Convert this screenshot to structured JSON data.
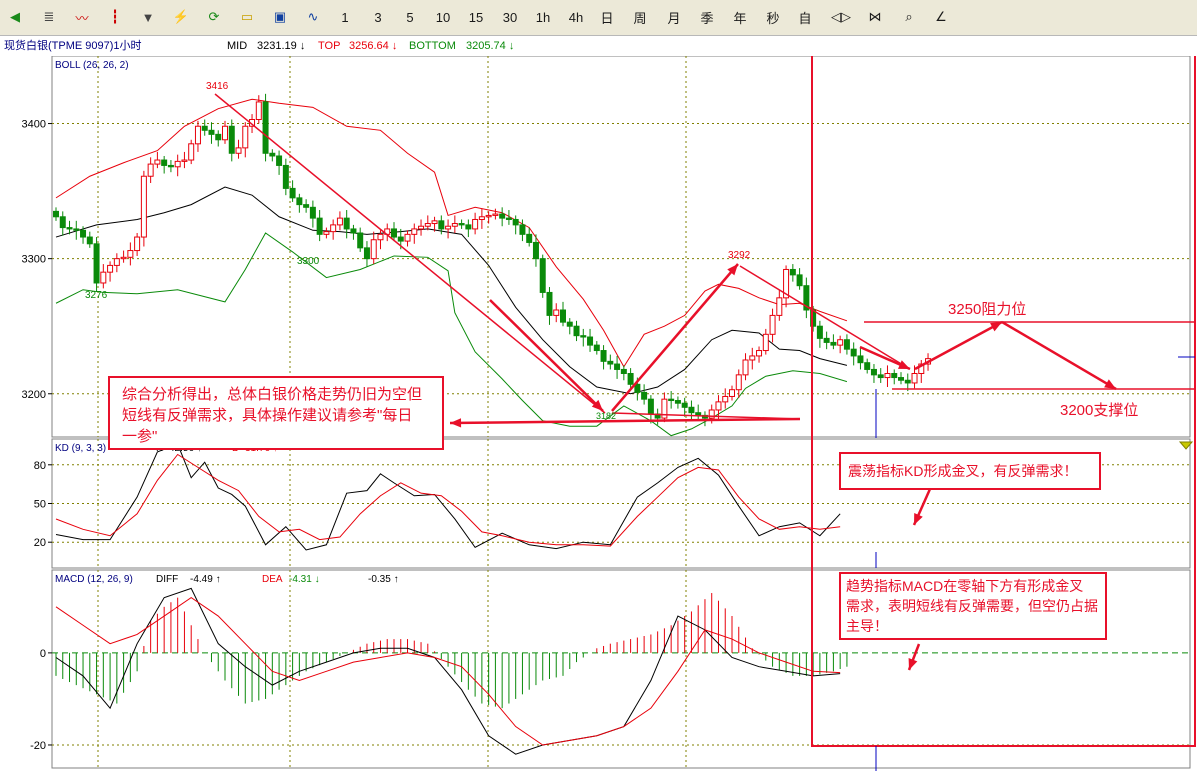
{
  "toolbar": {
    "icons": [
      {
        "name": "back-icon",
        "glyph": "◀"
      },
      {
        "name": "list-view-icon",
        "glyph": "≣"
      },
      {
        "name": "line-chart-icon",
        "glyph": "〰"
      },
      {
        "name": "candlestick-icon",
        "glyph": "┇"
      },
      {
        "name": "dropdown-icon",
        "glyph": "▼"
      },
      {
        "name": "lightning-icon",
        "glyph": "⚡"
      },
      {
        "name": "refresh-icon",
        "glyph": "⟳"
      },
      {
        "name": "open-folder-icon",
        "glyph": "▭"
      },
      {
        "name": "save-icon",
        "glyph": "▣"
      },
      {
        "name": "indicator-icon",
        "glyph": "∿"
      }
    ],
    "periods": [
      "1",
      "3",
      "5",
      "10",
      "15",
      "30",
      "1h",
      "4h",
      "日",
      "周",
      "月",
      "季",
      "年",
      "秒",
      "自"
    ],
    "tools": [
      {
        "name": "zoom-horizontal-icon",
        "glyph": "◁▷"
      },
      {
        "name": "zoom-fit-icon",
        "glyph": "⋈"
      },
      {
        "name": "search-icon",
        "glyph": "⌕"
      },
      {
        "name": "draw-icon",
        "glyph": "∠"
      }
    ]
  },
  "infobar": {
    "title": "现货白银(TPME 9097)1小时",
    "mid_label": "MID",
    "mid_value": "3231.19 ↓",
    "top_label": "TOP",
    "top_value": "3256.64 ↓",
    "bottom_label": "BOTTOM",
    "bottom_value": "3205.74 ↓"
  },
  "colors": {
    "up": "#e8000b",
    "down": "#0a8a0a",
    "mid": "#000000",
    "annotation": "#e8102a",
    "grid": "#808000"
  },
  "chart_data": [
    {
      "type": "candlestick",
      "title": "BOLL (26, 26, 2)",
      "yticks": [
        3400,
        3300,
        3200
      ],
      "ylim": [
        3168,
        3450
      ],
      "series": [
        {
          "name": "MID",
          "type": "line",
          "color": "#000000",
          "x": [
            0,
            6,
            12,
            16,
            20,
            25,
            29,
            33,
            38,
            42,
            46,
            51,
            55,
            60,
            64,
            68,
            72,
            76,
            80,
            85,
            89,
            93,
            97,
            100,
            104,
            107,
            110,
            113,
            117
          ],
          "y": [
            3316,
            3325,
            3329,
            3334,
            3340,
            3353,
            3347,
            3331,
            3321,
            3320,
            3318,
            3320,
            3322,
            3318,
            3295,
            3264,
            3240,
            3220,
            3205,
            3200,
            3205,
            3218,
            3240,
            3247,
            3245,
            3233,
            3232,
            3226,
            3221
          ]
        },
        {
          "name": "TOP",
          "type": "line",
          "color": "#e8000b",
          "x": [
            0,
            5,
            10,
            15,
            19,
            24,
            29,
            33,
            38,
            43,
            48,
            52,
            56,
            58,
            62,
            66,
            70,
            74,
            78,
            81,
            84,
            87,
            90,
            93,
            96,
            98,
            101,
            104,
            107,
            110,
            113,
            117
          ],
          "y": [
            3345,
            3361,
            3371,
            3380,
            3398,
            3411,
            3418,
            3415,
            3412,
            3398,
            3395,
            3378,
            3364,
            3332,
            3338,
            3334,
            3323,
            3294,
            3270,
            3247,
            3220,
            3244,
            3250,
            3258,
            3276,
            3281,
            3278,
            3271,
            3266,
            3267,
            3261,
            3254
          ]
        },
        {
          "name": "BOTTOM",
          "type": "line",
          "color": "#0a8a0a",
          "x": [
            0,
            4,
            7,
            12,
            18,
            25,
            28,
            31,
            35,
            40,
            45,
            50,
            55,
            58,
            59,
            62,
            66,
            69,
            72,
            76,
            80,
            84,
            88,
            91,
            94,
            97,
            100,
            102,
            105,
            109,
            113,
            117
          ],
          "y": [
            3267,
            3277,
            3275,
            3274,
            3277,
            3268,
            3292,
            3319,
            3305,
            3286,
            3292,
            3302,
            3301,
            3291,
            3260,
            3231,
            3211,
            3195,
            3180,
            3176,
            3176,
            3191,
            3180,
            3169,
            3174,
            3182,
            3191,
            3204,
            3213,
            3217,
            3215,
            3209
          ]
        },
        {
          "name": "Close",
          "type": "candles",
          "up_color": "#e8000b",
          "down_color": "#0a8a0a",
          "close": [
            3331,
            3323,
            3322,
            3321,
            3316,
            3311,
            3282,
            3290,
            3295,
            3300,
            3301,
            3306,
            3316,
            3361,
            3370,
            3373,
            3369,
            3368,
            3372,
            3373,
            3385,
            3398,
            3395,
            3392,
            3388,
            3398,
            3378,
            3382,
            3398,
            3403,
            3416,
            3378,
            3376,
            3369,
            3352,
            3345,
            3340,
            3338,
            3330,
            3318,
            3320,
            3325,
            3330,
            3322,
            3319,
            3308,
            3300,
            3314,
            3318,
            3322,
            3316,
            3313,
            3318,
            3322,
            3324,
            3326,
            3328,
            3322,
            3324,
            3326,
            3325,
            3322,
            3329,
            3331,
            3332,
            3333,
            3330,
            3329,
            3325,
            3318,
            3312,
            3300,
            3275,
            3258,
            3262,
            3253,
            3250,
            3243,
            3242,
            3236,
            3232,
            3224,
            3222,
            3218,
            3215,
            3207,
            3201,
            3196,
            3185,
            3182,
            3196,
            3195,
            3193,
            3190,
            3186,
            3184,
            3182,
            3188,
            3194,
            3198,
            3203,
            3214,
            3225,
            3228,
            3232,
            3244,
            3258,
            3271,
            3292,
            3288,
            3280,
            3262,
            3250,
            3241,
            3238,
            3236,
            3240,
            3233,
            3228,
            3223,
            3218,
            3214,
            3212,
            3215,
            3212,
            3210,
            3208,
            3215,
            3222,
            3226
          ]
        }
      ],
      "annotations": [
        {
          "text": "3416",
          "color": "#e8000b"
        },
        {
          "text": "3300",
          "color": "#0a8a0a"
        },
        {
          "text": "3276",
          "color": "#0a8a0a"
        },
        {
          "text": "3292",
          "color": "#e8000b"
        },
        {
          "text": "3182",
          "color": "#0a8a0a"
        },
        {
          "text": "3250阻力位",
          "color": "#e8102a"
        },
        {
          "text": "3200支撑位",
          "color": "#e8102a"
        },
        {
          "text": "综合分析得出，总体白银价格走势仍旧为空但短线有反弹需求，具体操作建议请参考\"每日一参\"",
          "color": "#e8102a"
        }
      ],
      "xlabel": "",
      "ylabel": ""
    },
    {
      "type": "line",
      "title": "KD (9, 3, 3)",
      "header": [
        {
          "label": "K",
          "value": "42.56 ↑"
        },
        {
          "label": "D",
          "value": "31.76 ↑"
        }
      ],
      "yticks": [
        80,
        50,
        20
      ],
      "ylim": [
        0,
        100
      ],
      "series": [
        {
          "name": "K",
          "color": "#000000",
          "x": [
            0,
            4,
            8,
            12,
            15,
            18,
            20,
            22,
            24,
            26,
            28,
            31,
            34,
            37,
            40,
            43,
            46,
            48,
            50,
            53,
            56,
            59,
            62,
            66,
            70,
            74,
            78,
            82,
            86,
            89,
            92,
            95,
            98,
            101,
            104,
            107,
            110,
            113,
            116
          ],
          "y": [
            26,
            22,
            22,
            55,
            90,
            96,
            70,
            82,
            62,
            57,
            48,
            18,
            32,
            14,
            18,
            58,
            60,
            73,
            66,
            56,
            57,
            38,
            16,
            27,
            18,
            15,
            20,
            18,
            55,
            66,
            78,
            85,
            72,
            48,
            25,
            32,
            35,
            25,
            42
          ]
        },
        {
          "name": "D",
          "color": "#e8000b",
          "x": [
            0,
            4,
            8,
            12,
            15,
            18,
            21,
            24,
            27,
            30,
            33,
            36,
            39,
            42,
            45,
            48,
            51,
            54,
            57,
            60,
            63,
            66,
            70,
            74,
            78,
            82,
            86,
            89,
            92,
            95,
            98,
            101,
            104,
            107,
            110,
            113,
            116
          ],
          "y": [
            38,
            30,
            25,
            42,
            68,
            88,
            78,
            68,
            60,
            40,
            28,
            30,
            22,
            24,
            42,
            56,
            66,
            58,
            56,
            44,
            28,
            25,
            20,
            18,
            18,
            17,
            40,
            55,
            70,
            78,
            76,
            55,
            38,
            30,
            32,
            30,
            32
          ]
        }
      ],
      "annotations": [
        {
          "text": "震荡指标KD形成金叉，有反弹需求！",
          "color": "#e8102a"
        }
      ]
    },
    {
      "type": "bar",
      "title": "MACD (12, 26, 9)",
      "header": [
        {
          "label": "DIFF",
          "value": "-4.49 ↑"
        },
        {
          "label": "DEA",
          "value": "-4.31 ↓"
        },
        {
          "label": "",
          "value": "-0.35 ↑"
        }
      ],
      "yticks": [
        0,
        -20
      ],
      "ylim": [
        -25,
        18
      ],
      "series": [
        {
          "name": "MACD",
          "type": "bars",
          "x": [
            0,
            3,
            6,
            9,
            12,
            14,
            16,
            18,
            20,
            22,
            25,
            28,
            31,
            34,
            37,
            40,
            43,
            46,
            49,
            52,
            55,
            58,
            61,
            63,
            66,
            69,
            72,
            75,
            77,
            80,
            82,
            85,
            88,
            91,
            94,
            97,
            100,
            103,
            106,
            109,
            112,
            115,
            117
          ],
          "values": [
            -5,
            -7,
            -9,
            -11,
            -4,
            7,
            10,
            12,
            6,
            0,
            -6,
            -11,
            -10,
            -7,
            -4,
            -2,
            0,
            2,
            3,
            3,
            2,
            -3,
            -8,
            -11,
            -12,
            -9,
            -6,
            -5,
            -2,
            1,
            2,
            3,
            4,
            6,
            9,
            13,
            8,
            1,
            -3,
            -5,
            -5,
            -4,
            -3
          ]
        },
        {
          "name": "DIFF",
          "color": "#000000",
          "x": [
            0,
            4,
            8,
            12,
            16,
            20,
            24,
            28,
            32,
            36,
            40,
            44,
            48,
            52,
            56,
            60,
            64,
            68,
            72,
            76,
            80,
            84,
            88,
            92,
            96,
            100,
            104,
            108,
            112,
            116
          ],
          "y": [
            -1,
            -5,
            -12,
            2,
            12,
            14,
            2,
            -3,
            -7,
            -4,
            -2,
            0,
            1,
            1,
            -1,
            -8,
            -18,
            -22,
            -20,
            -19,
            -18,
            -16,
            -6,
            8,
            5,
            -1,
            -3,
            -4,
            -5,
            -4.5
          ]
        },
        {
          "name": "DEA",
          "color": "#e8000b",
          "x": [
            0,
            4,
            8,
            12,
            16,
            20,
            24,
            28,
            32,
            36,
            40,
            44,
            48,
            52,
            56,
            60,
            64,
            68,
            72,
            76,
            80,
            84,
            88,
            92,
            96,
            100,
            104,
            108,
            112,
            116
          ],
          "y": [
            10,
            6,
            2,
            4,
            8,
            12,
            8,
            2,
            -4,
            -6,
            -4,
            -2,
            -1,
            0,
            -1,
            -3,
            -9,
            -16,
            -20,
            -19,
            -18,
            -16,
            -12,
            -4,
            5,
            3,
            0,
            -2,
            -4,
            -4.3
          ]
        }
      ],
      "annotations": [
        {
          "text": "趋势指标MACD在零轴下方有形成金叉需求，表明短线有反弹需要，但空仍占据主导！",
          "color": "#e8102a"
        }
      ]
    }
  ]
}
